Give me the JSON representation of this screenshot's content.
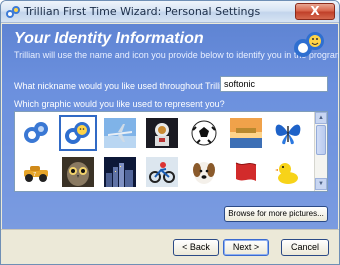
{
  "window": {
    "title": "Trillian First Time Wizard: Personal Settings",
    "close_symbol": "X"
  },
  "header": {
    "heading": "Your Identity Information",
    "subtext": "Trillian will use the name and icon you provide below to identify you in the program.",
    "icon": "trillian-logo-icon"
  },
  "form": {
    "nickname_question": "What nickname would you like used throughout Trillian?",
    "nickname_value": "softonic",
    "graphic_question": "Which graphic would you like used to represent you?"
  },
  "gallery": {
    "rows": [
      [
        {
          "name": "trillian-blue-icon"
        },
        {
          "name": "trillian-smiley-icon",
          "selected": true
        },
        {
          "name": "jet-plane-icon"
        },
        {
          "name": "astronaut-icon"
        },
        {
          "name": "soccer-ball-icon"
        },
        {
          "name": "beach-sunset-icon"
        },
        {
          "name": "blue-butterfly-icon"
        }
      ],
      [
        {
          "name": "toy-race-car-icon"
        },
        {
          "name": "owl-icon"
        },
        {
          "name": "city-skyline-icon"
        },
        {
          "name": "motocross-bike-icon"
        },
        {
          "name": "dog-icon"
        },
        {
          "name": "red-ribbon-icon"
        },
        {
          "name": "rubber-duck-icon"
        }
      ]
    ],
    "scroll_up_symbol": "▲",
    "scroll_down_symbol": "▼"
  },
  "buttons": {
    "browse": "Browse for more pictures...",
    "back": "< Back",
    "next": "Next >",
    "cancel": "Cancel"
  },
  "colors": {
    "panel_blue": "#6b90de",
    "selection_blue": "#316ac5",
    "heading_white": "#ffffff"
  }
}
